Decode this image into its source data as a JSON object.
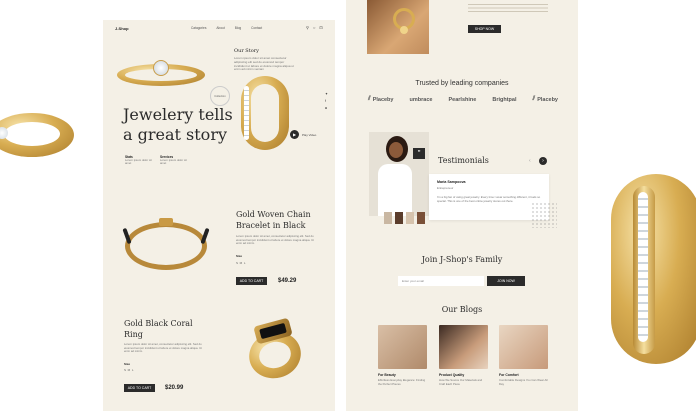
{
  "brand": "J-Shop",
  "nav": [
    "Catagories",
    "About",
    "Blog",
    "Contact"
  ],
  "hero": {
    "title_line1": "Jewelery tells",
    "title_line2": "a great story",
    "our_story_heading": "Our Story",
    "our_story_text": "Lorem ipsum dolor sit amet consectetur adipiscing elit sed do eiusmod tempor incididunt ut labore et dolore magna aliqua ut enim ad minim veniam",
    "badge": "Collection",
    "play_label": "Play Video",
    "stat1_title": "Stats",
    "stat1_text": "Lorem ipsum dolor sit amet",
    "stat2_title": "Services",
    "stat2_text": "Lorem ipsum dolor sit amet"
  },
  "products": [
    {
      "name_line1": "Gold Woven Chain",
      "name_line2": "Bracelet in Black",
      "desc": "Lorem ipsum dolor sit amet, consectetur adipiscing elit. Sed do eiusmod tempor incididunt ut labore et dolore magna aliqua. Ut enim ad minim.",
      "size_label": "Size",
      "sizes": "S  M  L",
      "button": "ADD TO CART",
      "price": "$49.29"
    },
    {
      "name_line1": "Gold Black Coral",
      "name_line2": "Ring",
      "desc": "Lorem ipsum dolor sit amet, consectetur adipiscing elit. Sed do eiusmod tempor incididunt ut labore et dolore magna aliqua. Ut enim ad minim.",
      "size_label": "Size",
      "sizes": "S  M  L",
      "button": "ADD TO CART",
      "price": "$20.99"
    }
  ],
  "trusted": {
    "heading": "Trusted by leading companies",
    "logos": [
      "Placeby",
      "umbrace",
      "Pearlshine",
      "Brightpal",
      "Placeby"
    ]
  },
  "testimonials": {
    "heading": "Testimonials",
    "name": "Maria Sampoova",
    "role": "Entrepreneur",
    "quote": "I'm a big fan of using great jewelry. Every time I wear something different, it feels so special. This is one of the best online jewelry stores out there."
  },
  "family": {
    "heading": "Join J-Shop's Family",
    "placeholder": "Enter your email",
    "button": "JOIN NOW"
  },
  "blogs": {
    "heading": "Our Blogs",
    "items": [
      {
        "title": "For Beauty",
        "text": "Effortless Everyday Elegance: Finding the Perfect Pieces"
      },
      {
        "title": "Product Quality",
        "text": "How We Source Our Materials and Craft Each Piece"
      },
      {
        "title": "For Comfort",
        "text": "Comfortable Designs You Can Wear All Day"
      }
    ]
  },
  "top_button": "SHOP NOW"
}
